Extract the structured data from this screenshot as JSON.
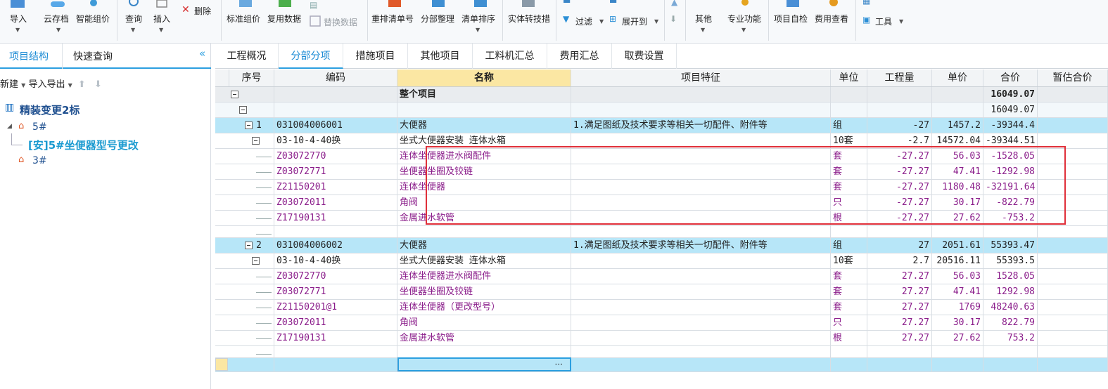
{
  "toolbar": {
    "import": "导入",
    "cloud": "云存档",
    "smart_price": "智能组价",
    "query": "查询",
    "insert": "插入",
    "delete": "删除",
    "std_price": "标准组价",
    "reuse_data": "复用数据",
    "replace_data": "替换数据",
    "resort_code": "重排清单号",
    "section_tidy": "分部整理",
    "list_sort": "清单排序",
    "convert_entity": "实体转技措",
    "filter": "过滤",
    "expand_to": "展开到",
    "other": "其他",
    "pro_func": "专业功能",
    "self_check": "项目自检",
    "fee_view": "费用查看",
    "tools": "工具"
  },
  "left": {
    "tab_structure": "项目结构",
    "tab_quick": "快速查询",
    "new_btn": "新建",
    "import_export": "导入导出",
    "tree_root": "精装变更2标",
    "tree_5": "5#",
    "tree_5_child": "[安]5#坐便器型号更改",
    "tree_3": "3#"
  },
  "main_tabs": [
    "工程概况",
    "分部分项",
    "措施项目",
    "其他项目",
    "工料机汇总",
    "费用汇总",
    "取费设置"
  ],
  "grid": {
    "headers": [
      "序号",
      "编码",
      "名称",
      "项目特征",
      "单位",
      "工程量",
      "单价",
      "合价",
      "暂估合价"
    ],
    "rows": [
      {
        "type": "total",
        "seq": "",
        "code": "",
        "name": "整个项目",
        "feat": "",
        "unit": "",
        "qty": "",
        "price": "",
        "total": "16049.07"
      },
      {
        "type": "sub",
        "seq": "",
        "code": "",
        "name": "",
        "feat": "",
        "unit": "",
        "qty": "",
        "price": "",
        "total": "16049.07"
      },
      {
        "type": "sel",
        "seq": "1",
        "code": "031004006001",
        "name": "大便器",
        "feat": "1.满足图纸及技术要求等相关一切配件、附件等",
        "unit": "组",
        "qty": "-27",
        "price": "1457.2",
        "total": "-39344.4"
      },
      {
        "type": "item",
        "seq": "",
        "code": "03-10-4-40换",
        "name": "坐式大便器安装 连体水箱",
        "feat": "",
        "unit": "10套",
        "qty": "-2.7",
        "price": "14572.04",
        "total": "-39344.51"
      },
      {
        "type": "mat",
        "seq": "",
        "code": "Z03072770",
        "name": "连体坐便器进水阀配件",
        "feat": "",
        "unit": "套",
        "qty": "-27.27",
        "price": "56.03",
        "total": "-1528.05"
      },
      {
        "type": "mat",
        "seq": "",
        "code": "Z03072771",
        "name": "坐便器坐圈及铰链",
        "feat": "",
        "unit": "套",
        "qty": "-27.27",
        "price": "47.41",
        "total": "-1292.98"
      },
      {
        "type": "mat",
        "seq": "",
        "code": "Z21150201",
        "name": "连体坐便器",
        "feat": "",
        "unit": "套",
        "qty": "-27.27",
        "price": "1180.48",
        "total": "-32191.64"
      },
      {
        "type": "mat",
        "seq": "",
        "code": "Z03072011",
        "name": "角阀",
        "feat": "",
        "unit": "只",
        "qty": "-27.27",
        "price": "30.17",
        "total": "-822.79"
      },
      {
        "type": "mat",
        "seq": "",
        "code": "Z17190131",
        "name": "金属进水软管",
        "feat": "",
        "unit": "根",
        "qty": "-27.27",
        "price": "27.62",
        "total": "-753.2"
      },
      {
        "type": "blank",
        "seq": "",
        "code": "",
        "name": "",
        "feat": "",
        "unit": "",
        "qty": "",
        "price": "",
        "total": ""
      },
      {
        "type": "sel",
        "seq": "2",
        "code": "031004006002",
        "name": "大便器",
        "feat": "1.满足图纸及技术要求等相关一切配件、附件等",
        "unit": "组",
        "qty": "27",
        "price": "2051.61",
        "total": "55393.47"
      },
      {
        "type": "item",
        "seq": "",
        "code": "03-10-4-40换",
        "name": "坐式大便器安装 连体水箱",
        "feat": "",
        "unit": "10套",
        "qty": "2.7",
        "price": "20516.11",
        "total": "55393.5"
      },
      {
        "type": "mat",
        "seq": "",
        "code": "Z03072770",
        "name": "连体坐便器进水阀配件",
        "feat": "",
        "unit": "套",
        "qty": "27.27",
        "price": "56.03",
        "total": "1528.05"
      },
      {
        "type": "mat",
        "seq": "",
        "code": "Z03072771",
        "name": "坐便器坐圈及铰链",
        "feat": "",
        "unit": "套",
        "qty": "27.27",
        "price": "47.41",
        "total": "1292.98"
      },
      {
        "type": "mat",
        "seq": "",
        "code": "Z21150201@1",
        "name": "连体坐便器（更改型号）",
        "feat": "",
        "unit": "套",
        "qty": "27.27",
        "price": "1769",
        "total": "48240.63"
      },
      {
        "type": "mat",
        "seq": "",
        "code": "Z03072011",
        "name": "角阀",
        "feat": "",
        "unit": "只",
        "qty": "27.27",
        "price": "30.17",
        "total": "822.79"
      },
      {
        "type": "mat",
        "seq": "",
        "code": "Z17190131",
        "name": "金属进水软管",
        "feat": "",
        "unit": "根",
        "qty": "27.27",
        "price": "27.62",
        "total": "753.2"
      },
      {
        "type": "blank",
        "seq": "",
        "code": "",
        "name": "",
        "feat": "",
        "unit": "",
        "qty": "",
        "price": "",
        "total": ""
      },
      {
        "type": "sel",
        "seq": "",
        "code": "",
        "name": "",
        "feat": "",
        "unit": "",
        "qty": "",
        "price": "",
        "total": ""
      }
    ],
    "edit_ellipsis": "···"
  },
  "colors": {
    "accent": "#2b9fe0",
    "selected_row": "#b7e6f8",
    "material_text": "#8a1c8a",
    "highlight_box": "#e0303a",
    "name_header": "#fbe7a3"
  }
}
